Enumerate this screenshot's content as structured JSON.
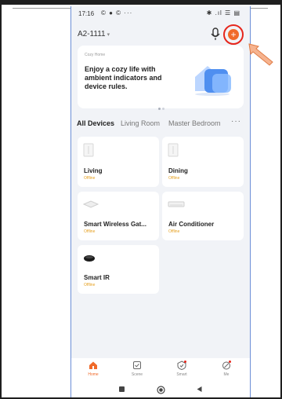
{
  "status_bar": {
    "time": "17:16",
    "left_icons": "© ● © ···",
    "right_icons": "✱ .ıl ☰ ▤"
  },
  "header": {
    "home_name": "A2-1111",
    "chevron": "▾",
    "add_symbol": "+"
  },
  "banner": {
    "tag": "Cozy Home",
    "text": "Enjoy a cozy life with ambient indicators and device rules."
  },
  "tabs": {
    "all": "All Devices",
    "living_room": "Living Room",
    "master_bedroom": "Master Bedroom",
    "more": "···"
  },
  "devices": [
    {
      "name": "Living",
      "status": "Offline",
      "icon": "wall-switch-icon"
    },
    {
      "name": "Dining",
      "status": "Offline",
      "icon": "wall-switch-icon"
    },
    {
      "name": "Smart Wireless Gat...",
      "status": "Offline",
      "icon": "gateway-icon"
    },
    {
      "name": "Air Conditioner",
      "status": "Offline",
      "icon": "air-conditioner-icon"
    },
    {
      "name": "Smart IR",
      "status": "Offline",
      "icon": "ir-remote-icon"
    }
  ],
  "tabbar": {
    "home": "Home",
    "scene": "Scene",
    "smart": "Smart",
    "me": "Me"
  },
  "colors": {
    "accent": "#f06a2a",
    "highlight": "#e6261c",
    "offline": "#e6a020",
    "arrow": "#f4a07a"
  }
}
